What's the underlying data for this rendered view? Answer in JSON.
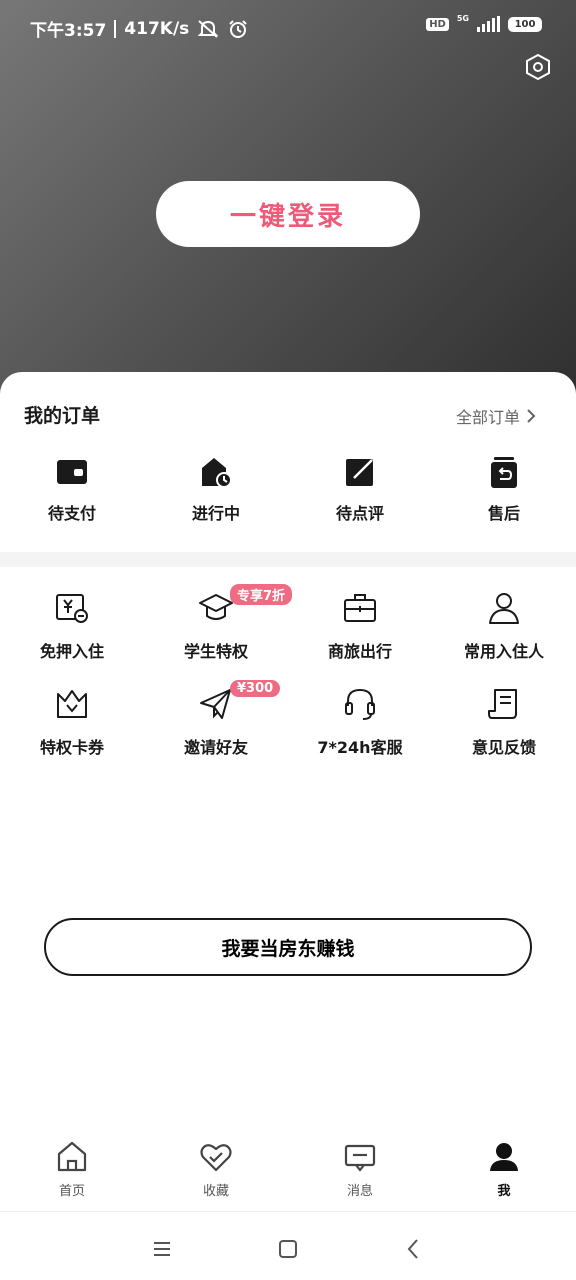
{
  "status_bar": {
    "time": "下午3:57",
    "speed": "417K/s",
    "hd": "HD",
    "network": "5G",
    "battery": "100"
  },
  "header": {
    "login_label": "一键登录"
  },
  "orders": {
    "title": "我的订单",
    "all_label": "全部订单",
    "items": [
      {
        "label": "待支付",
        "icon": "wallet-icon"
      },
      {
        "label": "进行中",
        "icon": "house-clock-icon"
      },
      {
        "label": "待点评",
        "icon": "edit-icon"
      },
      {
        "label": "售后",
        "icon": "return-icon"
      }
    ]
  },
  "services": {
    "row1": [
      {
        "label": "免押入住",
        "icon": "deposit-free-icon"
      },
      {
        "label": "学生特权",
        "icon": "graduation-cap-icon",
        "badge": "专享7折"
      },
      {
        "label": "商旅出行",
        "icon": "briefcase-icon"
      },
      {
        "label": "常用入住人",
        "icon": "person-icon"
      }
    ],
    "row2": [
      {
        "label": "特权卡券",
        "icon": "crown-icon"
      },
      {
        "label": "邀请好友",
        "icon": "paper-plane-icon",
        "badge": "¥300"
      },
      {
        "label": "7*24h客服",
        "icon": "headset-icon"
      },
      {
        "label": "意见反馈",
        "icon": "feedback-icon"
      }
    ]
  },
  "landlord": {
    "label": "我要当房东赚钱"
  },
  "tabs": [
    {
      "label": "首页",
      "icon": "home-icon"
    },
    {
      "label": "收藏",
      "icon": "heart-icon"
    },
    {
      "label": "消息",
      "icon": "message-icon"
    },
    {
      "label": "我",
      "icon": "user-icon",
      "active": true
    }
  ],
  "colors": {
    "accent": "#ee5a78",
    "badge": "#ee6b83",
    "header_dark": "#2e2e2e",
    "header_light": "#777777"
  }
}
